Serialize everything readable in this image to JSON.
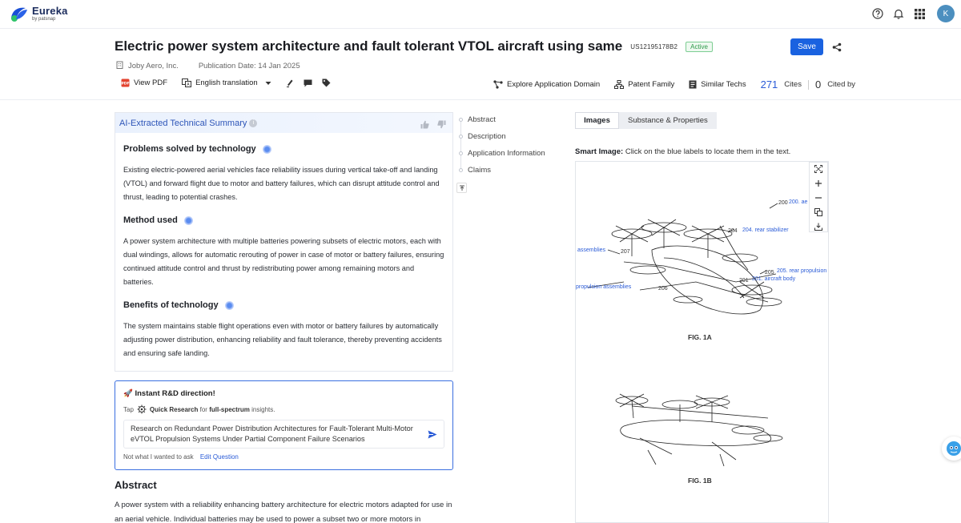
{
  "app": {
    "name": "Eureka",
    "sub": "by patsnap",
    "avatar_initial": "K"
  },
  "patent": {
    "title": "Electric power system architecture and fault tolerant VTOL aircraft using same",
    "number": "US12195178B2",
    "status": "Active",
    "assignee": "Joby Aero, Inc.",
    "publication_date": "Publication Date: 14 Jan 2025"
  },
  "actions": {
    "save": "Save"
  },
  "toolbar": {
    "view_pdf": "View PDF",
    "translation": "English translation",
    "explore": "Explore Application Domain",
    "family": "Patent Family",
    "similar": "Similar Techs",
    "cites_count": "271",
    "cites_label": "Cites",
    "cited_count": "0",
    "cited_label": "Cited by"
  },
  "summary": {
    "title": "AI-Extracted Technical Summary",
    "sections": [
      {
        "title": "Problems solved by technology",
        "text": "Existing electric-powered aerial vehicles face reliability issues during vertical take-off and landing (VTOL) and forward flight due to motor and battery failures, which can disrupt attitude control and thrust, leading to potential crashes."
      },
      {
        "title": "Method used",
        "text": "A power system architecture with multiple batteries powering subsets of electric motors, each with dual windings, allows for automatic rerouting of power in case of motor or battery failures, ensuring continued attitude control and thrust by redistributing power among remaining motors and batteries."
      },
      {
        "title": "Benefits of technology",
        "text": "The system maintains stable flight operations even with motor or battery failures by automatically adjusting power distribution, enhancing reliability and fault tolerance, thereby preventing accidents and ensuring safe landing."
      }
    ]
  },
  "rd": {
    "title": "🚀 Instant R&D direction!",
    "tap": "Tap",
    "quick": "Quick Research",
    "for": "for",
    "full": "full-spectrum",
    "insights": "insights.",
    "query": "Research on Redundant Power Distribution Architectures for Fault-Tolerant Multi-Motor eVTOL Propulsion Systems Under Partial Component Failure Scenarios",
    "not_wanted": "Not what I wanted to ask",
    "edit": "Edit Question"
  },
  "abstract": {
    "heading": "Abstract",
    "text": "A power system with a reliability enhancing battery architecture for electric motors adapted for use in an aerial vehicle. Individual batteries may be used to power a subset two or more motors in"
  },
  "nav": {
    "items": [
      "Abstract",
      "Description",
      "Application Information",
      "Claims"
    ]
  },
  "images": {
    "tabs": [
      "Images",
      "Substance & Properties"
    ],
    "smart_label": "Smart Image:",
    "smart_text": "Click on the blue labels to locate them in the text.",
    "labels": {
      "l200": "200. ae",
      "l204": "204. rear stabilizer",
      "l205": "205. rear propulsion",
      "l201": "201. aircraft body",
      "assemblies": "assemblies",
      "propulsion": "propulsion assemblies",
      "n200": "200",
      "n204": "204",
      "n207": "207",
      "n206": "206",
      "n201": "201",
      "n205": "205"
    },
    "fig1a": "FIG. 1A",
    "fig1b": "FIG. 1B"
  }
}
